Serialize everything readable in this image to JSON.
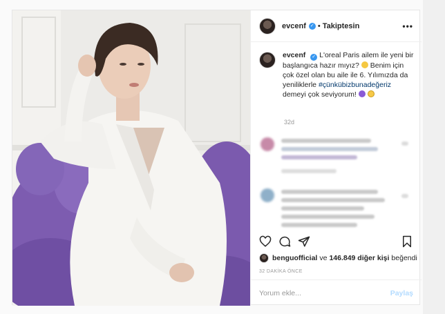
{
  "header": {
    "username": "evcenf",
    "separator": "•",
    "follow_label": "Takiptesin",
    "more_label": "•••"
  },
  "caption": {
    "username": "evcenf",
    "text_before": "L'oreal Paris ailem ile yeni bir başlangıca hazır mıyız?",
    "text_middle": "Benim için çok özel olan bu aile ile 6. Yılımızda da yeniliklerle",
    "hashtag": "#çünkübizbunadeğeriz",
    "text_after": "demeyi çok seviyorum!",
    "time": "32d"
  },
  "actions": {
    "like_icon": "heart-icon",
    "comment_icon": "comment-icon",
    "share_icon": "paper-plane-icon",
    "save_icon": "bookmark-icon"
  },
  "likes": {
    "first_user": "benguofficial",
    "connector": "ve",
    "count_text": "146.849 diğer kişi",
    "suffix": "beğendi"
  },
  "timestamp": "32 DAKİKA ÖNCE",
  "comment_box": {
    "placeholder": "Yorum ekle...",
    "post_label": "Paylaş"
  },
  "colors": {
    "verified": "#3897f0",
    "hashtag": "#00376b",
    "post_button_disabled": "#b3dbff",
    "chair_purple": "#7d5cb0"
  }
}
